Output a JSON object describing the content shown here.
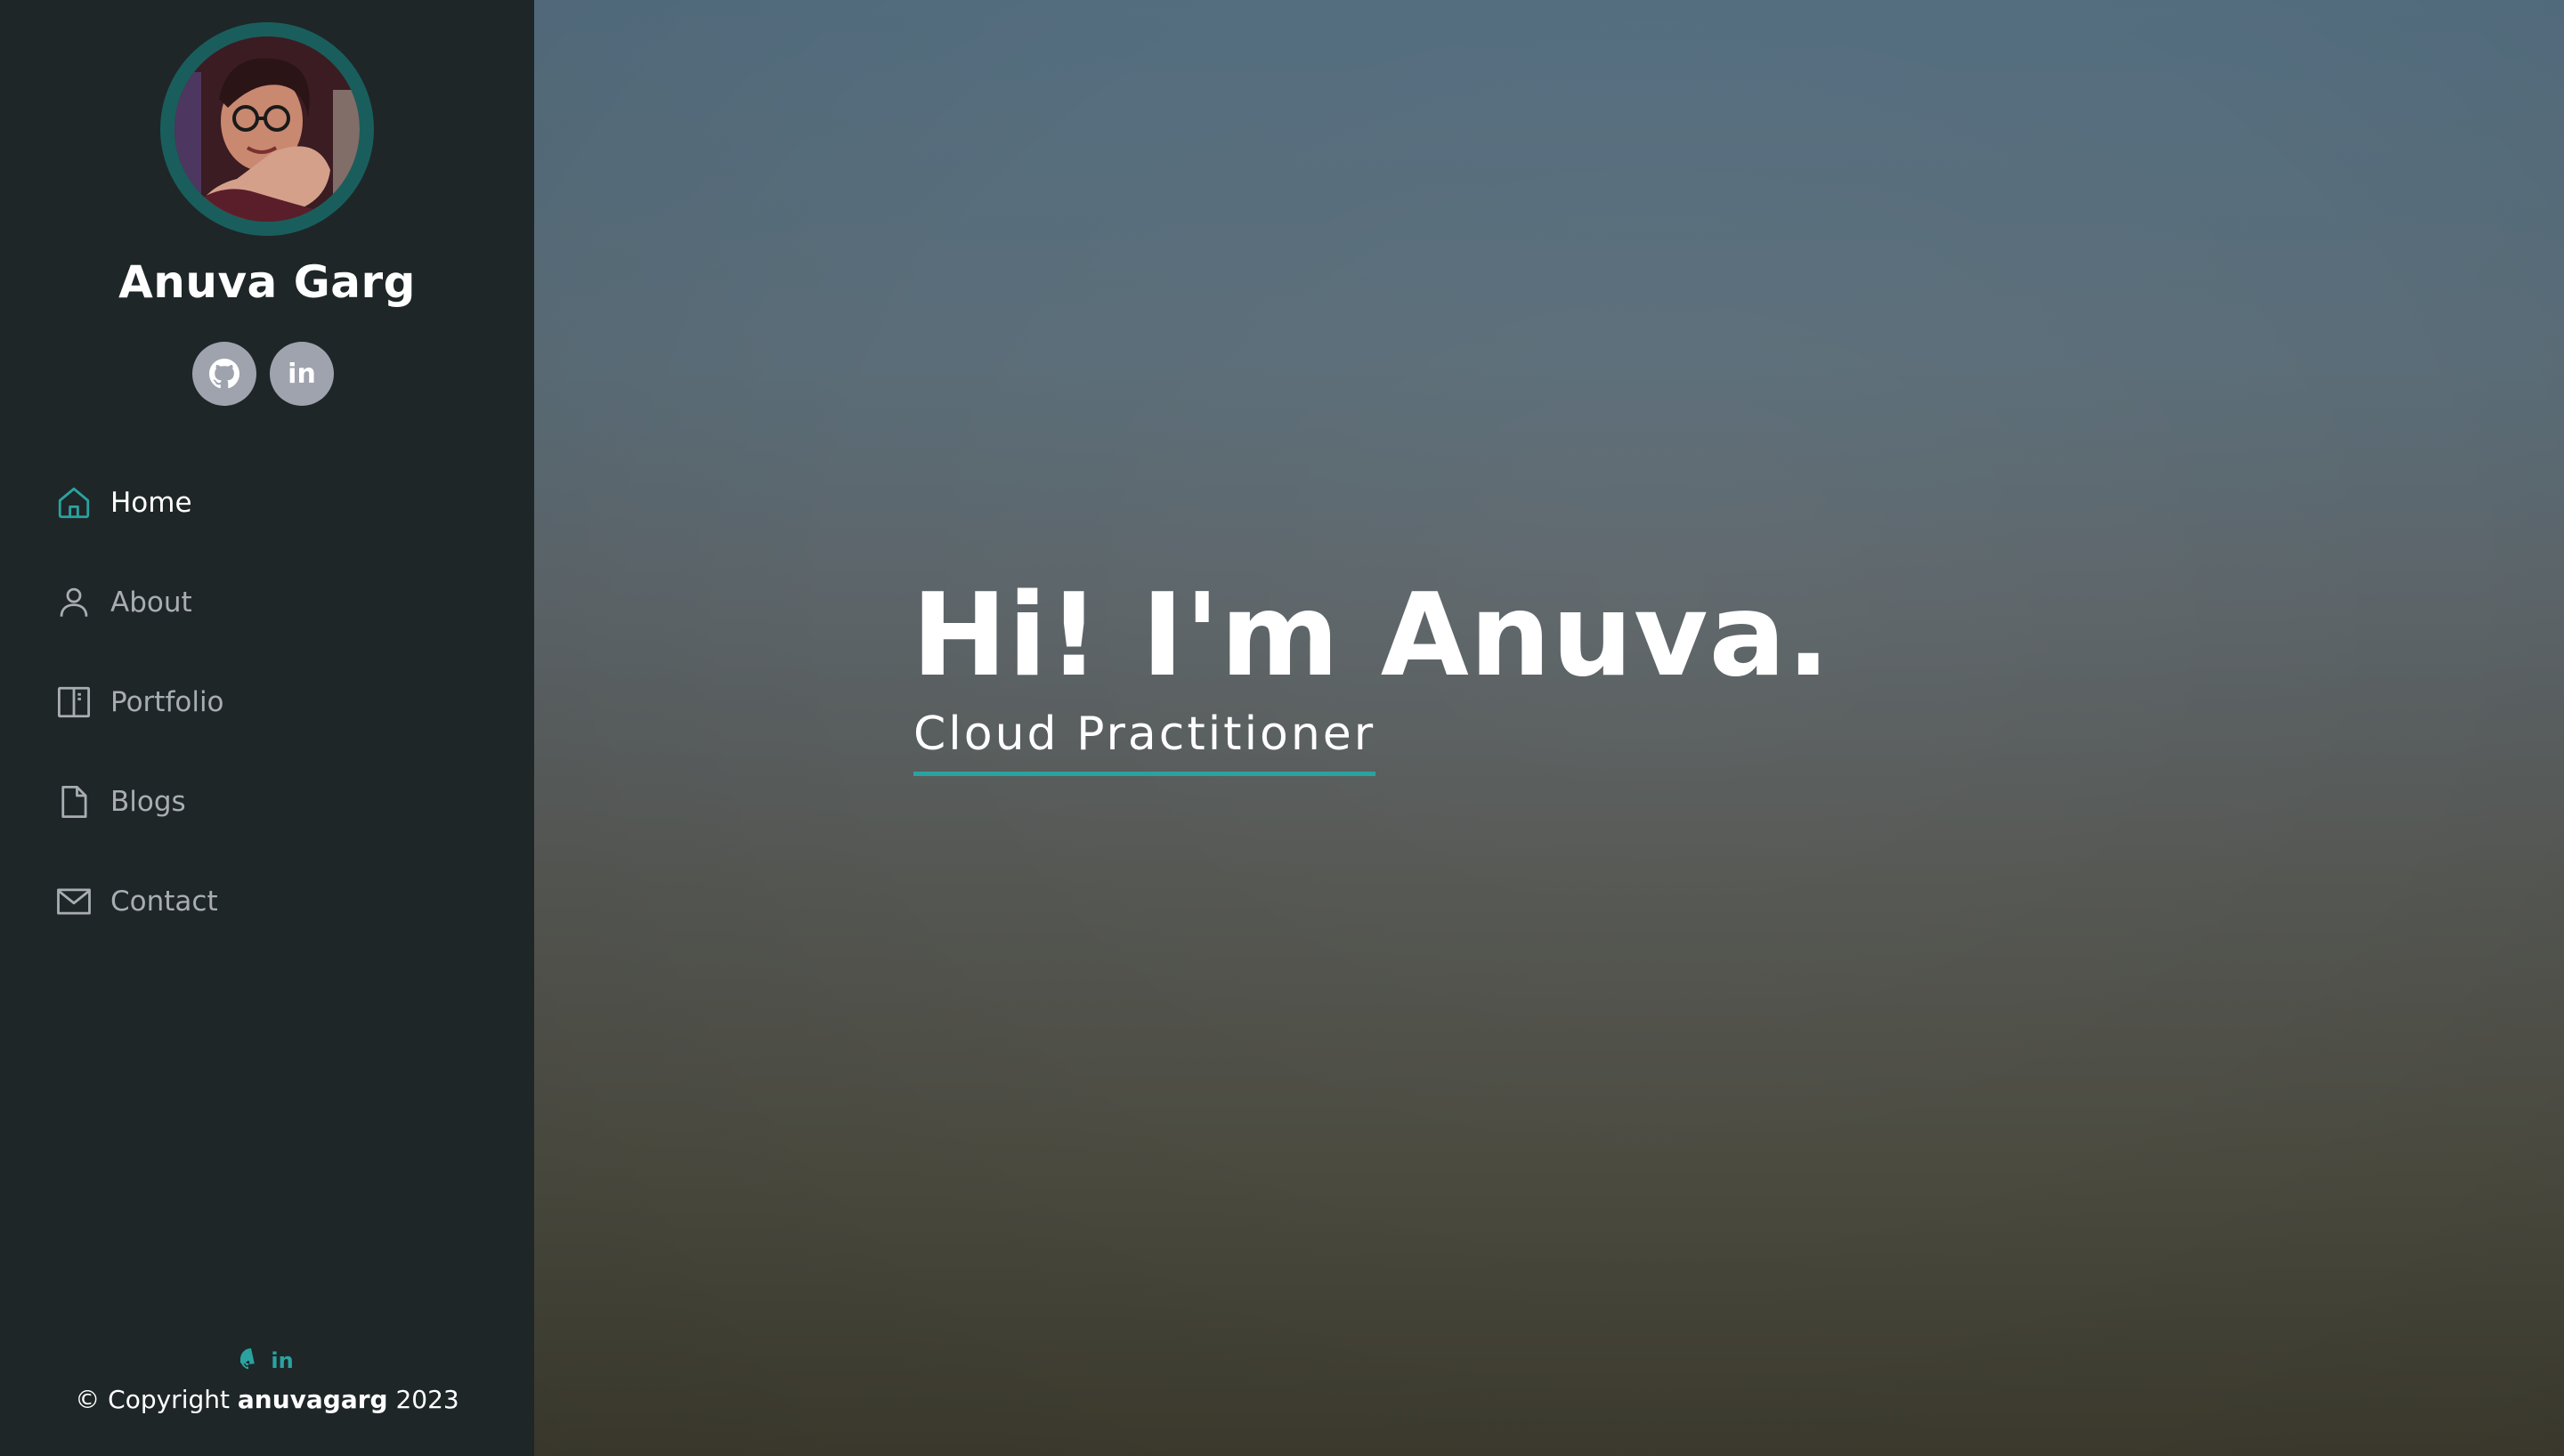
{
  "profile": {
    "name": "Anuva Garg",
    "photo_alt": "profile photo"
  },
  "social": {
    "github_icon": "github-icon",
    "linkedin_label": "in"
  },
  "nav": {
    "items": [
      {
        "label": "Home",
        "icon": "home-icon",
        "active": true
      },
      {
        "label": "About",
        "icon": "person-icon",
        "active": false
      },
      {
        "label": "Portfolio",
        "icon": "book-icon",
        "active": false
      },
      {
        "label": "Blogs",
        "icon": "file-icon",
        "active": false
      },
      {
        "label": "Contact",
        "icon": "envelope-icon",
        "active": false
      }
    ]
  },
  "footer": {
    "linkedin_label": "in",
    "copyright_prefix": "© Copyright ",
    "copyright_name": "anuvagarg",
    "copyright_year": " 2023"
  },
  "hero": {
    "title": "Hi! I'm Anuva.",
    "subtitle": "Cloud Practitioner"
  },
  "colors": {
    "accent": "#2aa3a0",
    "sidebar_bg": "#1f2628",
    "social_btn": "#9ea3ae"
  }
}
